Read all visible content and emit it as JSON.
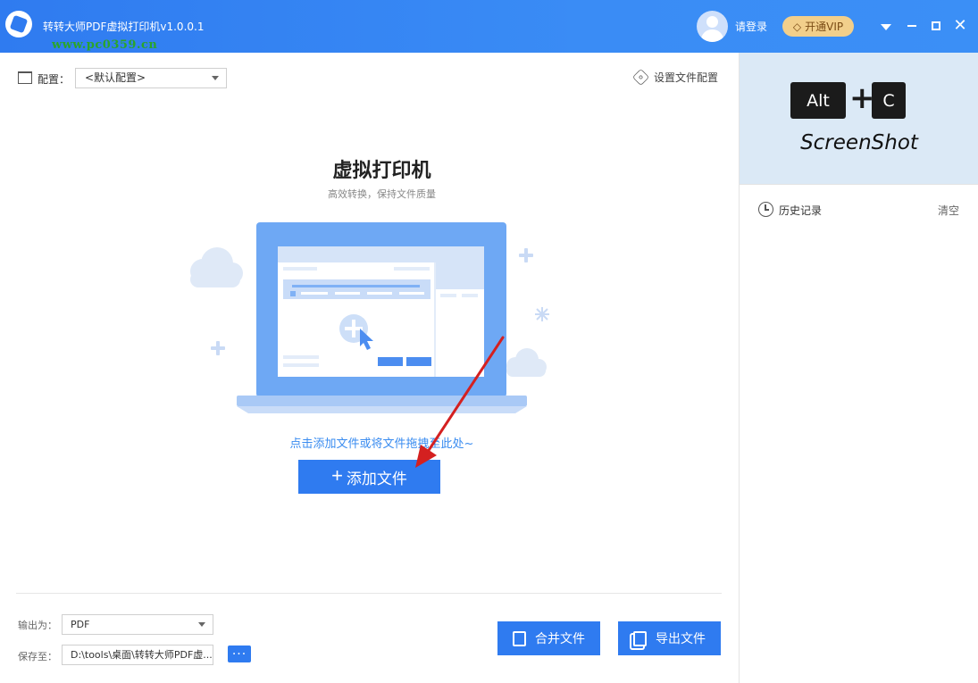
{
  "app": {
    "title": "转转大师PDF虚拟打印机v1.0.0.1",
    "watermark": "www.pc0359.cn",
    "login": "请登录",
    "vip": "开通VIP"
  },
  "config": {
    "label": "配置：",
    "selected": "<默认配置>",
    "settings_link": "设置文件配置"
  },
  "main": {
    "title": "虚拟打印机",
    "subtitle": "高效转换，保持文件质量",
    "hint": "点击添加文件或将文件拖拽至此处~",
    "add_button": "添加文件",
    "add_plus": "+"
  },
  "bottom": {
    "output_label": "输出为：",
    "output_value": "PDF",
    "save_label": "保存至：",
    "save_path": "D:\\tools\\桌面\\转转大师PDF虚...",
    "browse": "···",
    "merge_button": "合并文件",
    "export_button": "导出文件"
  },
  "right_panel": {
    "banner_key1": "Alt",
    "banner_plus": "+",
    "banner_key2": "C",
    "banner_text": "ScreenShot",
    "history_label": "历史记录",
    "clear": "清空"
  },
  "colors": {
    "accent": "#2f7bf0",
    "vip_gold": "#f2cf8b",
    "hint_blue": "#3a8cf0",
    "arrow_red": "#d42020"
  }
}
